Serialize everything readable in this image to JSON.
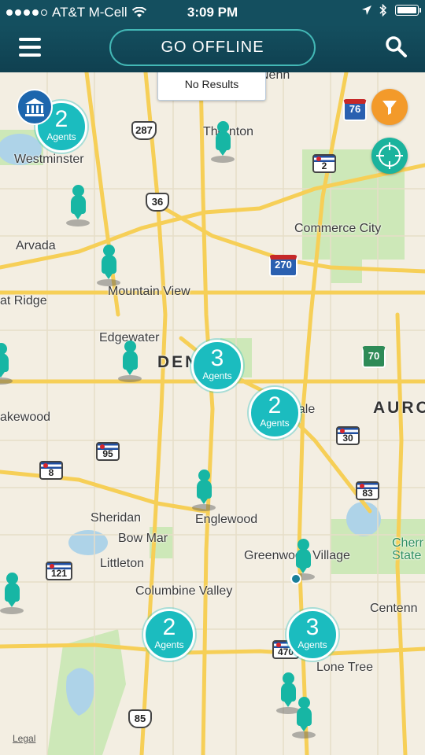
{
  "status_bar": {
    "carrier": "AT&T M-Cell",
    "time": "3:09 PM"
  },
  "header": {
    "offline_button": "GO OFFLINE"
  },
  "search_result": {
    "message": "No Results"
  },
  "clusters": [
    {
      "count": "2",
      "label": "Agents"
    },
    {
      "count": "3",
      "label": "Agents"
    },
    {
      "count": "2",
      "label": "Agents"
    },
    {
      "count": "2",
      "label": "Agents"
    },
    {
      "count": "3",
      "label": "Agents"
    }
  ],
  "map_labels": {
    "westminster": "Westminster",
    "thornton": "Thornton",
    "arvada": "Arvada",
    "commerce_city": "Commerce City",
    "mountain_view": "Mountain View",
    "wheat_ridge": "at Ridge",
    "edgewater": "Edgewater",
    "denver": "DENV",
    "lakewood": "akewood",
    "aurora": "AURO",
    "dale": "dale",
    "sheridan": "Sheridan",
    "englewood": "Englewood",
    "bow_mar": "Bow Mar",
    "littleton": "Littleton",
    "greenwood_village": "Greenwood Village",
    "cherry_state": "Cherr",
    "cherry_state_2": "State",
    "columbine_valley": "Columbine Valley",
    "centennial": "Centenn",
    "lone_tree": "Lone Tree",
    "top_cut": "Nenn"
  },
  "shields": {
    "i76": "76",
    "us287": "287",
    "us36": "36",
    "co2": "2",
    "i270": "270",
    "i70": "70",
    "co95": "95",
    "co8": "8",
    "co30": "30",
    "co83": "83",
    "co121": "121",
    "co470": "470",
    "us85": "85"
  },
  "footer": {
    "legal": "Legal"
  },
  "colors": {
    "teal": "#1bbcbf",
    "navy": "#144f5f",
    "orange": "#f39a2a",
    "agent": "#17b6a4"
  }
}
